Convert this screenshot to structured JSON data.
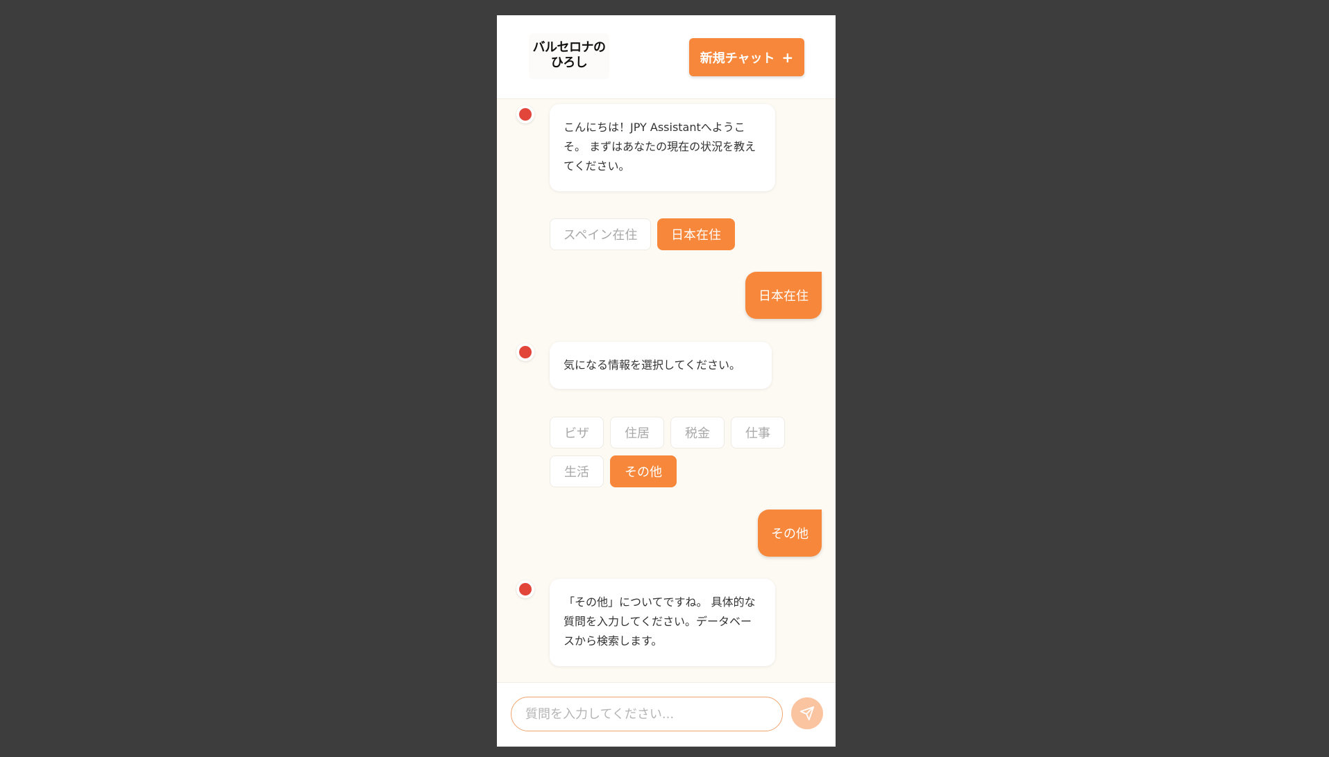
{
  "header": {
    "logo_line1": "バルセロナの",
    "logo_line2": "ひろし",
    "new_chat_label": "新規チャット",
    "new_chat_icon": "+"
  },
  "messages": {
    "bot1": "こんにちは！JPY Assistantへようこそ。 まずはあなたの現在の状況を教えてください。",
    "residence_options": [
      "スペイン在住",
      "日本在住"
    ],
    "user1": "日本在住",
    "bot2": "気になる情報を選択してください。",
    "topic_options": [
      "ビザ",
      "住居",
      "税金",
      "仕事",
      "生活",
      "その他"
    ],
    "user2": "その他",
    "bot3": "「その他」についてですね。 具体的な質問を入力してください。データベースから検索します。"
  },
  "input": {
    "placeholder": "質問を入力してください...",
    "value": ""
  },
  "icons": {
    "avatar": "bot-avatar-icon",
    "send": "send-icon"
  },
  "colors": {
    "accent": "#f7873a",
    "avatar_dot": "#e2453a",
    "send_disabled": "#fbc4a0"
  }
}
